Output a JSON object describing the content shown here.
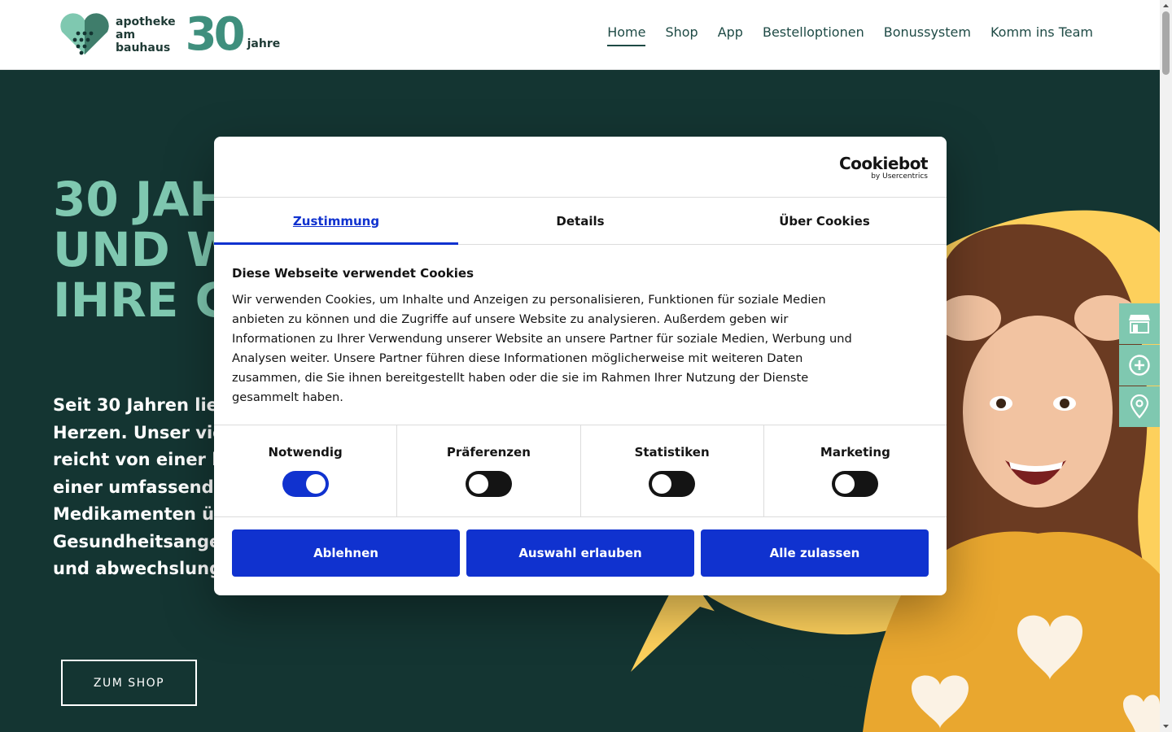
{
  "header": {
    "logo": {
      "line1": "apotheke",
      "line2": "am",
      "line3": "bauhaus",
      "number": "30",
      "suffix": "jahre"
    },
    "nav": [
      {
        "label": "Home",
        "active": true
      },
      {
        "label": "Shop"
      },
      {
        "label": "App"
      },
      {
        "label": "Bestelloptionen"
      },
      {
        "label": "Bonussystem"
      },
      {
        "label": "Komm ins Team"
      }
    ]
  },
  "hero": {
    "title_lines": [
      "30 JAH",
      "UND W",
      "IHRE G"
    ],
    "text_lines": [
      "Seit 30 Jahren lie",
      "Herzen. Unser vie",
      "reicht von einer k",
      "einer umfassende",
      "Medikamenten üb",
      "Gesundheitsange",
      "und abwechslung"
    ],
    "cta": "ZUM SHOP"
  },
  "side_links": [
    {
      "icon": "store-icon"
    },
    {
      "icon": "plus-circle-icon"
    },
    {
      "icon": "location-pin-icon"
    }
  ],
  "cookie_dialog": {
    "brand": "Cookiebot",
    "brand_sub": "by Usercentrics",
    "tabs": [
      {
        "label": "Zustimmung",
        "active": true
      },
      {
        "label": "Details"
      },
      {
        "label": "Über Cookies"
      }
    ],
    "heading": "Diese Webseite verwendet Cookies",
    "body_lines": [
      "Wir verwenden Cookies, um Inhalte und Anzeigen zu personalisieren, Funktionen für soziale Medien",
      "anbieten zu können und die Zugriffe auf unsere Website zu analysieren. Außerdem geben wir",
      "Informationen zu Ihrer Verwendung unserer Website an unsere Partner für soziale Medien, Werbung und",
      "Analysen weiter. Unsere Partner führen diese Informationen möglicherweise mit weiteren Daten",
      "zusammen, die Sie ihnen bereitgestellt haben oder die sie im Rahmen Ihrer Nutzung der Dienste",
      "gesammelt haben."
    ],
    "categories": [
      {
        "label": "Notwendig",
        "on": true
      },
      {
        "label": "Präferenzen",
        "on": false
      },
      {
        "label": "Statistiken",
        "on": false
      },
      {
        "label": "Marketing",
        "on": false
      }
    ],
    "buttons": {
      "decline": "Ablehnen",
      "allow_selection": "Auswahl erlauben",
      "allow_all": "Alle zulassen"
    },
    "colors": {
      "accent": "#1032cf",
      "toggle_off": "#141414"
    }
  },
  "colors": {
    "hero_bg": "#143532",
    "hero_title": "#7fc8b0",
    "accent_yellow": "#fdd05c"
  }
}
